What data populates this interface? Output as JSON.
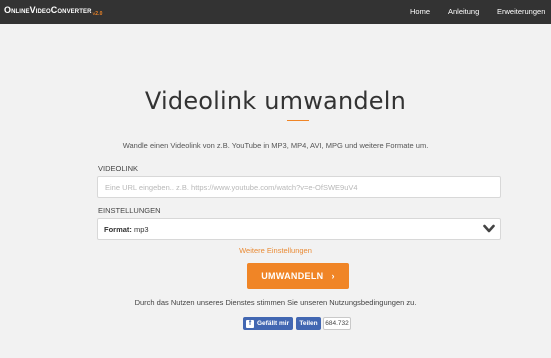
{
  "nav": {
    "logo": "OnlineVideoConverter",
    "version": "v2.0",
    "links": [
      "Home",
      "Anleitung",
      "Erweiterungen"
    ]
  },
  "main": {
    "title": "Videolink umwandeln",
    "subtitle": "Wandle einen Videolink von z.B. YouTube in MP3, MP4, AVI, MPG und weitere Formate um.",
    "videolink_label": "VIDEOLINK",
    "url_placeholder": "Eine URL eingeben.. z.B. https://www.youtube.com/watch?v=e-OfSWE9uV4",
    "settings_label": "EINSTELLUNGEN",
    "format_label": "Format:",
    "format_value": "mp3",
    "more_settings": "Weitere Einstellungen",
    "convert_button": "UMWANDELN",
    "convert_arrow": "›",
    "terms": "Durch das Nutzen unseres Dienstes stimmen Sie unseren Nutzungsbedingungen zu."
  },
  "social": {
    "like_label": "Gefällt mir",
    "share_label": "Teilen",
    "count": "684.732"
  },
  "colors": {
    "accent": "#f08526",
    "navbar": "#333333",
    "background": "#f2f2f2",
    "facebook": "#4267b2"
  }
}
